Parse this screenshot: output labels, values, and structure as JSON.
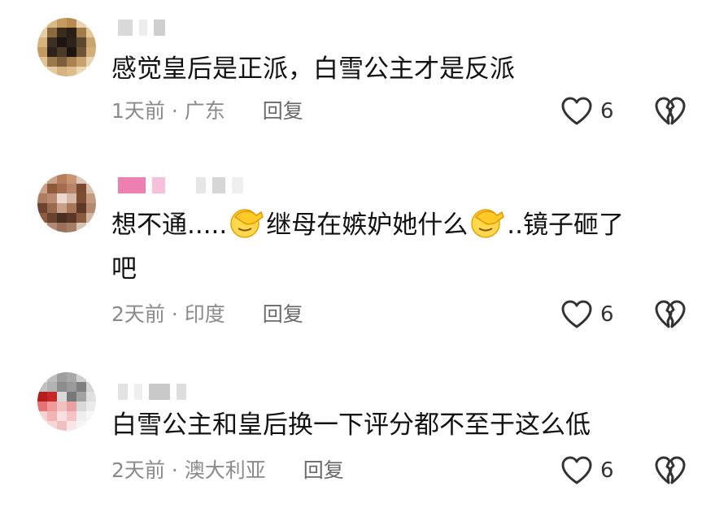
{
  "comments": [
    {
      "text": "感觉皇后是正派，白雪公主才是反派",
      "time": "1天前",
      "location": "广东",
      "reply_label": "回复",
      "likes": "6"
    },
    {
      "text_part1": "想不通.....",
      "text_part2": "继母在嫉妒她什么",
      "text_part3": "..镜子砸了",
      "text_line2": "吧",
      "time": "2天前",
      "location": "印度",
      "reply_label": "回复",
      "likes": "6"
    },
    {
      "text": "白雪公主和皇后换一下评分都不至于这么低",
      "time": "2天前",
      "location": "澳大利亚",
      "reply_label": "回复",
      "likes": "6"
    }
  ],
  "colors": {
    "text": "#121212",
    "meta": "#8a8a8a",
    "icon": "#333333"
  },
  "icons": [
    "heart-outline-icon",
    "broken-heart-icon",
    "facepalm-emoji-icon"
  ]
}
